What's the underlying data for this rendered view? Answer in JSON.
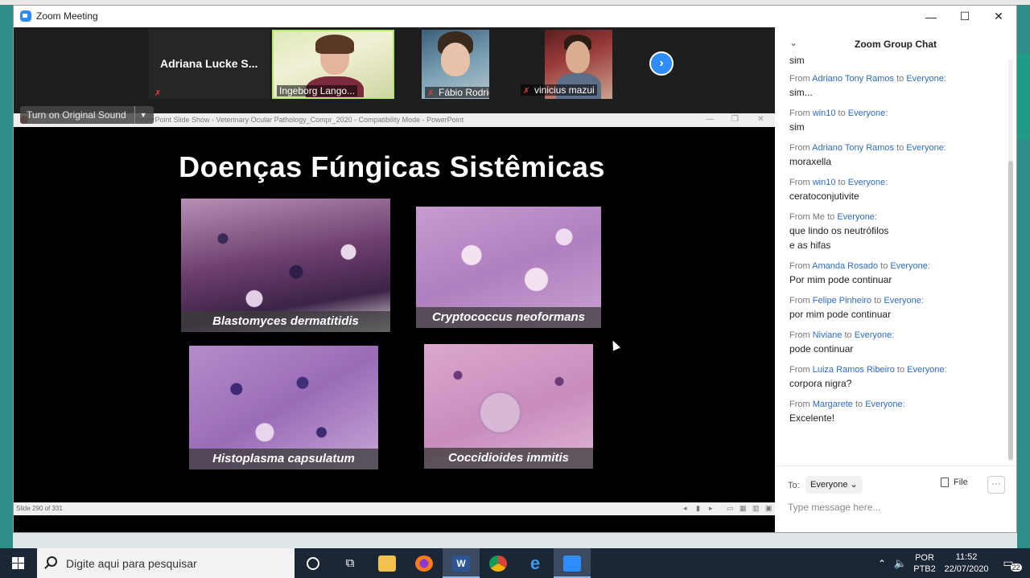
{
  "window": {
    "title": "Zoom Meeting",
    "minimize": "—",
    "maximize": "☐",
    "close": "✕"
  },
  "participants": [
    {
      "name": "Adriana Lucke S...",
      "label": ""
    },
    {
      "name": "",
      "label": "Ingeborg Lango..."
    },
    {
      "name": "",
      "label": "Fábio Rodrig..."
    },
    {
      "name": "",
      "label": "vinicius mazui"
    }
  ],
  "share": {
    "original_sound": "Turn on Original Sound",
    "ppt_title": "PowerPoint Slide Show  -  Veterinary Ocular Pathology_Compr_2020  -  Compatibility Mode - PowerPoint",
    "slide_title": "Doenças Fúngicas Sistêmicas",
    "images": [
      {
        "caption": "Blastomyces dermatitidis"
      },
      {
        "caption": "Cryptococcus neoformans"
      },
      {
        "caption": "Histoplasma capsulatum"
      },
      {
        "caption": "Coccidioides immitis"
      }
    ],
    "slide_number": "Slide 290 of 331"
  },
  "chat": {
    "title": "Zoom Group Chat",
    "partial_first": "sim",
    "messages": [
      {
        "from": "Adriano Tony Ramos",
        "to": "Everyone",
        "text": "sim..."
      },
      {
        "from": "win10",
        "to": "Everyone",
        "text": "sim"
      },
      {
        "from": "Adriano Tony Ramos",
        "to": "Everyone",
        "text": "moraxella"
      },
      {
        "from": "win10",
        "to": "Everyone",
        "text": "ceratoconjutivite"
      },
      {
        "from": "Me",
        "to": "Everyone",
        "text": "que lindo os neutrófilos",
        "text2": "e as hifas"
      },
      {
        "from": "Amanda Rosado",
        "to": "Everyone",
        "text": "Por mim pode continuar"
      },
      {
        "from": "Felipe Pinheiro",
        "to": "Everyone",
        "text": "por mim pode continuar"
      },
      {
        "from": "Niviane",
        "to": "Everyone",
        "text": "pode continuar"
      },
      {
        "from": "Luiza Ramos Ribeiro",
        "to": "Everyone",
        "text": "corpora nigra?"
      },
      {
        "from": "Margarete",
        "to": "Everyone",
        "text": "Excelente!"
      }
    ],
    "from_word": "From",
    "to_word": "to",
    "to_label": "To:",
    "recipient": "Everyone",
    "file_label": "File",
    "more_label": "···",
    "input_placeholder": "Type message here..."
  },
  "taskbar": {
    "search_placeholder": "Digite aqui para pesquisar",
    "lang_top": "POR",
    "lang_bottom": "PTB2",
    "time": "11:52",
    "date": "22/07/2020",
    "notifications": "22"
  },
  "colors": {
    "zoom_blue": "#2d8cff",
    "chat_link": "#2d6cc8",
    "taskbar": "#1b2737"
  }
}
